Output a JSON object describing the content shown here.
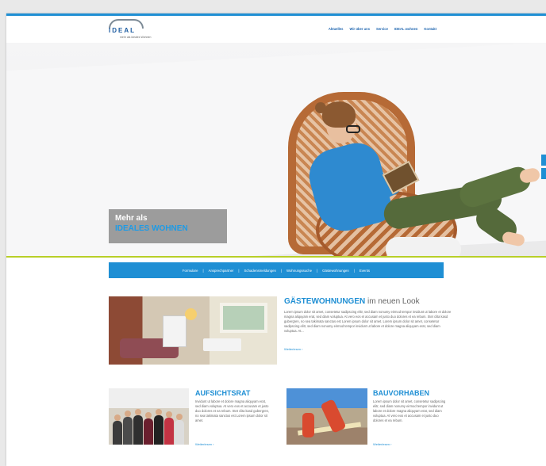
{
  "brand": {
    "name": "IDEAL",
    "tagline": "mehr als ideales Wohnen"
  },
  "nav": [
    "Aktuelles",
    "Wir über uns",
    "Service",
    "IDEAL wohnen",
    "Kontakt"
  ],
  "hero": {
    "line1": "Mehr als",
    "line2": "IDEALES WOHNEN"
  },
  "subnav": [
    "Formulare",
    "Ansprechpartner",
    "Schadensmeldungen",
    "Wohnungssuche",
    "Gästewohnungen",
    "Events"
  ],
  "articles": [
    {
      "title": "GÄSTEWOHNUNGEN",
      "title_rest": " im neuen Look",
      "body": "Lorem ipsum dolor sit amet, consetetur sadipscing elitr, sed diam nonumy eirmod tempor invidunt ut labore et dolore magna aliquyam erat, sed diam voluptua. At vero eos et accusam et justo duo dolores et ea rebum. Stet clita kasd gubergren, no sea takimata sanctus est Lorem ipsum dolor sit amet. Lorem ipsum dolor sit amet, consetetur sadipscing elitr, sed diam nonumy eirmod tempor invidunt ut labore et dolore magna aliquyam erat, sed diam voluptua. At...",
      "more": "Weiterlesen ›"
    },
    {
      "title": "AUFSICHTSRAT",
      "body": "Invidunt ut labore et dolore magna aliquyam erat, sed diam voluptua. At vero eos et accusam et justo duo dolores et ea rebum. Stet clita kasd gubergren, no sea takimata sanctus est Lorem ipsum dolor sit amet.",
      "more": "Weiterlesen ›"
    },
    {
      "title": "BAUVORHABEN",
      "body": "Lorem ipsum dolor sit amet, consetetur sadipscing elitr, sed diam nonumy eirmod tempor invidunt ut labore et dolore magna aliquyam erat, sed diam voluptua. At vero eos et accusam et justo duo dolores et ea rebum.",
      "more": "Weiterlesen ›"
    }
  ],
  "colors": {
    "primary": "#1f8fd4",
    "accent": "#b8cf28",
    "brand": "#1a5aa0"
  }
}
